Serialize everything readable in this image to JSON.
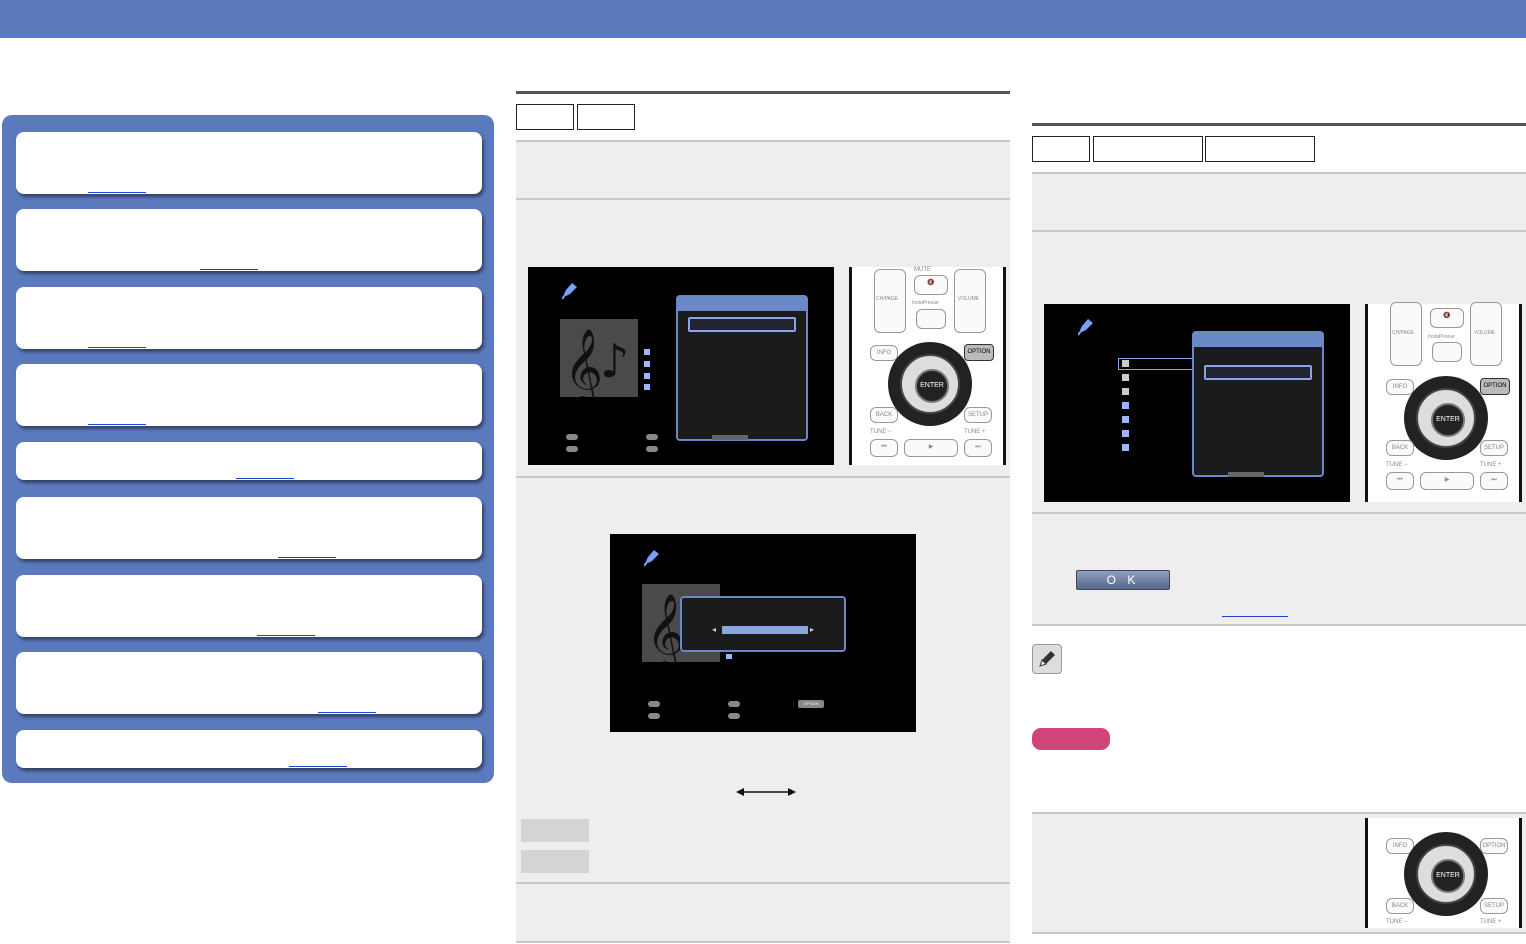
{
  "remote": {
    "mute": "MUTE",
    "channel": "CH/PAGE",
    "instaprevue": "InstaPrevue",
    "volume": "VOLUME",
    "info": "INFO",
    "option": "OPTION",
    "enter": "ENTER",
    "back": "BACK",
    "setup": "SETUP",
    "tune_minus": "TUNE −",
    "tune_plus": "TUNE +"
  },
  "screens": {
    "option_chip": "OPTION"
  },
  "dialog": {
    "ok_label": "O K"
  }
}
